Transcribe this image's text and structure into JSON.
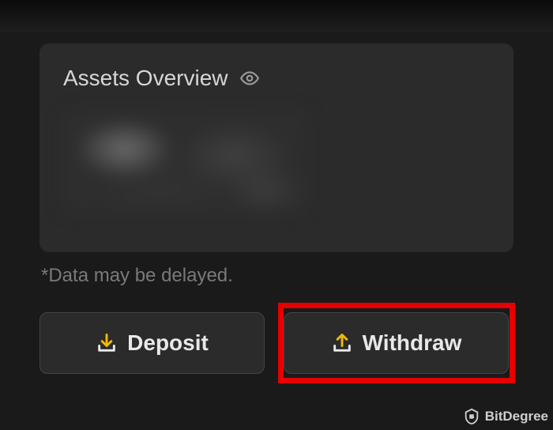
{
  "panel": {
    "title": "Assets Overview"
  },
  "disclaimer": "*Data may be delayed.",
  "buttons": {
    "deposit": "Deposit",
    "withdraw": "Withdraw"
  },
  "watermark": {
    "brand": "BitDegree"
  },
  "colors": {
    "accent": "#f0b90b",
    "highlight": "#e60000"
  }
}
